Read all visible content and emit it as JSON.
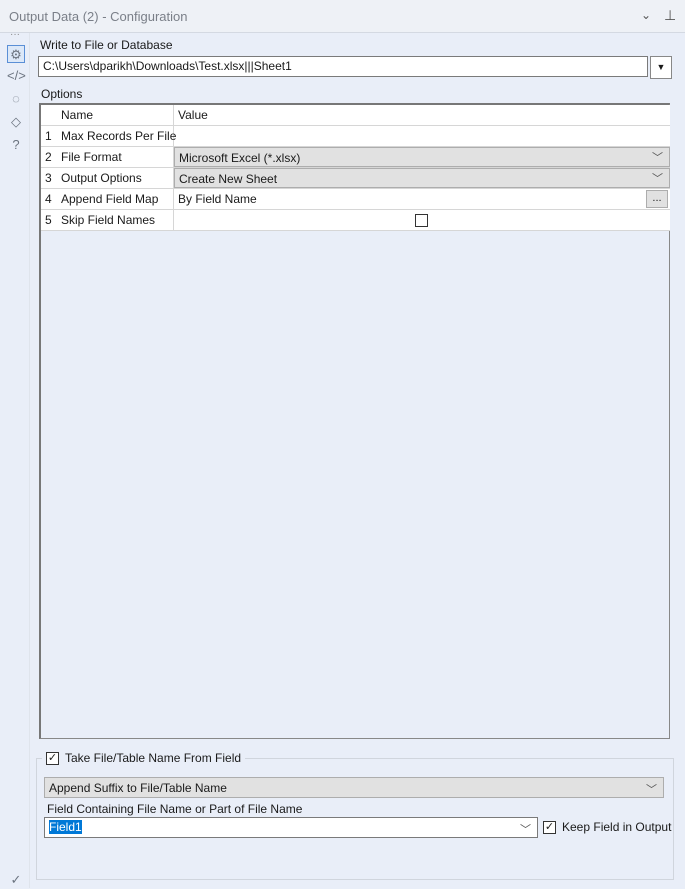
{
  "header": {
    "title": "Output Data (2) - Configuration"
  },
  "write_label": "Write to File or Database",
  "path_value": "C:\\Users\\dparikh\\Downloads\\Test.xlsx|||Sheet1",
  "options_label": "Options",
  "grid": {
    "headers": {
      "name": "Name",
      "value": "Value"
    },
    "rows": [
      {
        "num": "1",
        "name": "Max Records Per File",
        "value": ""
      },
      {
        "num": "2",
        "name": "File Format",
        "value": "Microsoft Excel (*.xlsx)"
      },
      {
        "num": "3",
        "name": "Output Options",
        "value": "Create New Sheet"
      },
      {
        "num": "4",
        "name": "Append Field Map",
        "value": "By Field Name",
        "button": "..."
      },
      {
        "num": "5",
        "name": "Skip Field Names",
        "value": ""
      }
    ]
  },
  "take_name": {
    "label": "Take File/Table Name From Field",
    "checked": true,
    "mode": "Append Suffix to File/Table Name",
    "field_label": "Field Containing File Name or Part of File Name",
    "field_value": "Field1",
    "keep_label": "Keep Field in Output",
    "keep_checked": true
  }
}
